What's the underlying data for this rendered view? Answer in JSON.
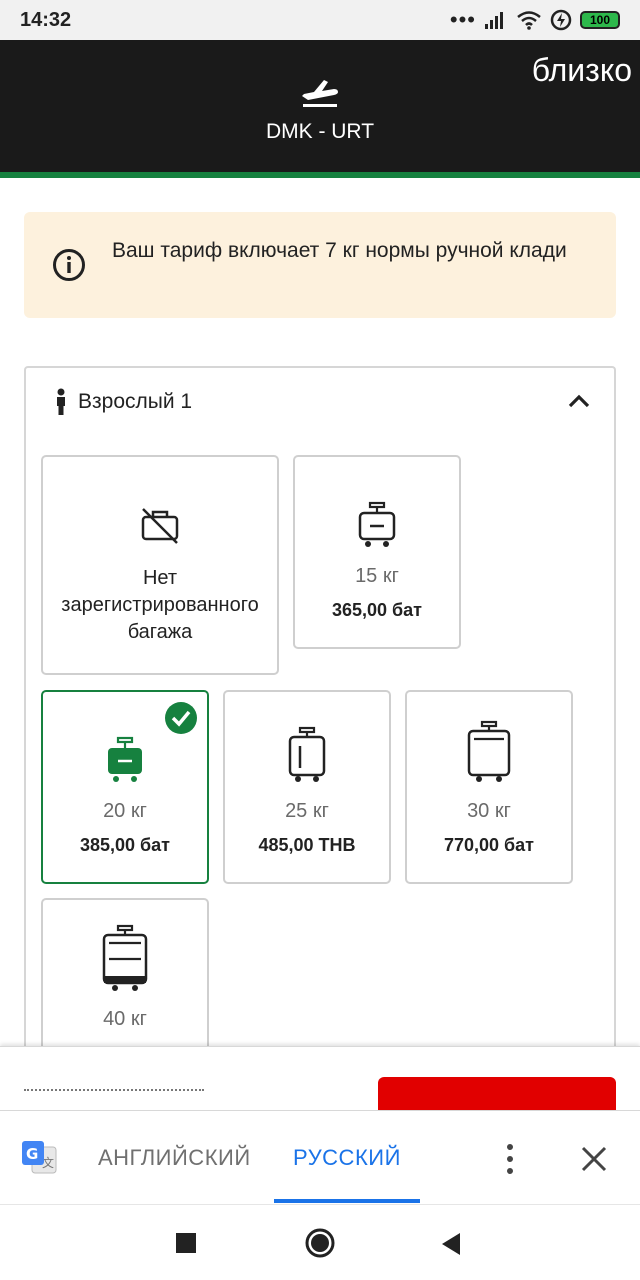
{
  "status_bar": {
    "time": "14:32",
    "battery": "100",
    "icons": [
      "more-dots-icon",
      "signal-icon",
      "wifi-icon",
      "charging-icon",
      "battery-icon"
    ]
  },
  "header": {
    "close_label": "близко",
    "route": "DMK - URT",
    "icon": "plane-departure-icon",
    "accent_color": "#16813f"
  },
  "info": {
    "text": "Ваш тариф включает 7 кг нормы ручной клади",
    "icon": "info-icon"
  },
  "passenger": {
    "label": "Взрослый 1",
    "icon": "person-icon"
  },
  "baggage_options": [
    {
      "label": "Нет зарегистрированного багажа",
      "icon": "no-baggage-icon"
    },
    {
      "weight": "15 кг",
      "price": "365,00 бат",
      "icon": "suitcase-small-icon"
    },
    {
      "weight": "20 кг",
      "price": "385,00 бат",
      "icon": "suitcase-small-icon",
      "selected": true
    },
    {
      "weight": "25 кг",
      "price": "485,00 THB",
      "icon": "suitcase-medium-icon"
    },
    {
      "weight": "30 кг",
      "price": "770,00 бат",
      "icon": "suitcase-large-icon"
    },
    {
      "weight": "40 кг",
      "icon": "suitcase-xlarge-icon"
    }
  ],
  "translate_bar": {
    "lang_source": "АНГЛИЙСКИЙ",
    "lang_target": "РУССКИЙ",
    "accent_color": "#1a73e8"
  },
  "colors": {
    "selected_green": "#16813f",
    "cta_red": "#e10000",
    "info_bg": "#fdf1dd"
  }
}
